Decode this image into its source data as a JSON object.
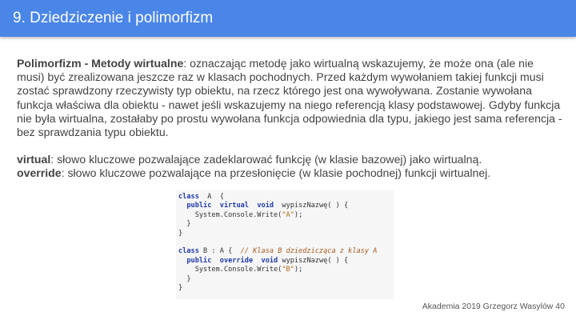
{
  "slide": {
    "title": "9. Dziedziczenie i polimorfizm",
    "paragraph1": {
      "term": "Polimorfizm - Metody wirtualne",
      "text": ": oznaczając metodę jako wirtualną wskazujemy, że może ona (ale nie musi) być zrealizowana jeszcze raz w klasach pochodnych. Przed każdym wywołaniem takiej funkcji musi zostać sprawdzony rzeczywisty typ obiektu, na rzecz którego jest ona wywoływana. Zostanie wywołana funkcja właściwa dla obiektu - nawet jeśli wskazujemy na niego referencją klasy podstawowej. Gdyby funkcja nie była wirtualna, zostałaby po prostu wywołana funkcja odpowiednia dla typu, jakiego jest sama referencja - bez sprawdzania typu obiektu."
    },
    "virtual_def": {
      "term": "virtual",
      "text": ": słowo kluczowe pozwalające zadeklarować funkcję (w klasie bazowej) jako wirtualną."
    },
    "override_def": {
      "term": "override",
      "text": ": słowo kluczowe pozwalające na przesłonięcie (w klasie pochodnej) funkcji wirtualnej."
    },
    "footer": "Akademia 2019 Grzegorz Wasylów 40"
  },
  "code": {
    "l1_kw": "class",
    "l1_rest": "  A  {",
    "l2_kw1": "public",
    "l2_kw2": "virtual",
    "l2_kw3": "void",
    "l2_rest": "  wypiszNazwę( ) {",
    "l3_pre": "System.Console.Write(",
    "l3_str": "\"A\"",
    "l3_post": ");",
    "l4": "}",
    "l5": "}",
    "l7_kw": "class",
    "l7_rest": " B : A {  ",
    "l7_comment": "// Klasa B dziedzicząca z klasy A",
    "l8_kw1": "public",
    "l8_kw2": "override",
    "l8_kw3": "void",
    "l8_rest": " wypiszNazwę( ) {",
    "l9_pre": "System.Console.Write(",
    "l9_str": "\"B\"",
    "l9_post": ");",
    "l10": "}",
    "l11": "}"
  }
}
